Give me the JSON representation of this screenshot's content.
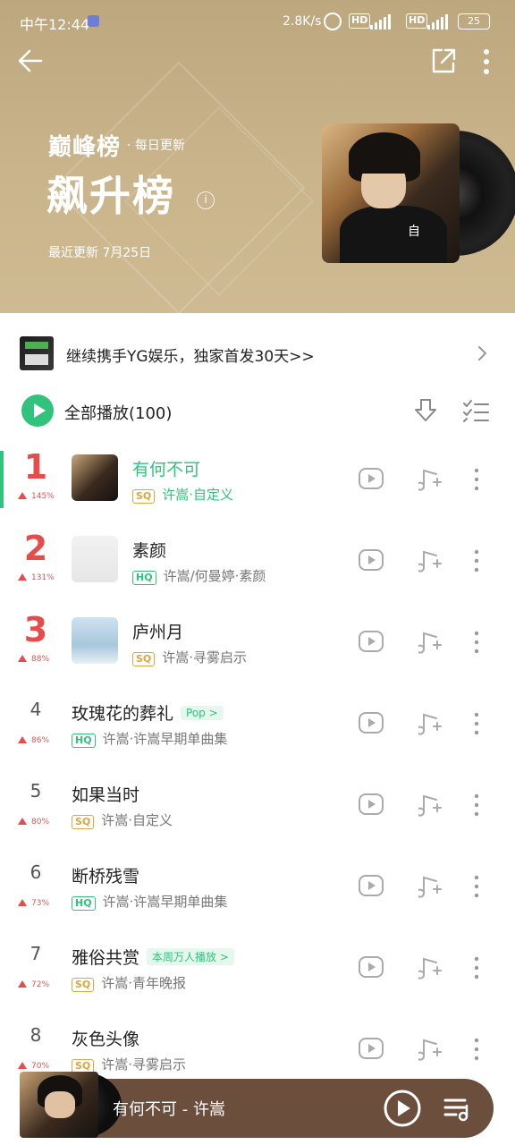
{
  "status_bar": {
    "time": "中午12:44",
    "speed": "2.8K/s",
    "battery": "25",
    "hd1": "HD",
    "hd2": "HD"
  },
  "header": {
    "brand": "巅峰榜",
    "update_freq": "· 每日更新",
    "title": "飙升榜",
    "updated": "最近更新 7月25日",
    "cover_char": "自"
  },
  "promo": {
    "text": "继续携手YG娱乐，独家首发30天>>"
  },
  "play_all": {
    "label": "全部播放(100)"
  },
  "songs": [
    {
      "rank": "1",
      "trend": "145%",
      "title": "有何不可",
      "quality": "SQ",
      "artist": "许嵩·自定义",
      "tag": ""
    },
    {
      "rank": "2",
      "trend": "131%",
      "title": "素颜",
      "quality": "HQ",
      "artist": "许嵩/何曼婷·素颜",
      "tag": ""
    },
    {
      "rank": "3",
      "trend": "88%",
      "title": "庐州月",
      "quality": "SQ",
      "artist": "许嵩·寻雾启示",
      "tag": ""
    },
    {
      "rank": "4",
      "trend": "86%",
      "title": "玫瑰花的葬礼",
      "quality": "HQ",
      "artist": "许嵩·许嵩早期单曲集",
      "tag": "Pop >"
    },
    {
      "rank": "5",
      "trend": "80%",
      "title": "如果当时",
      "quality": "SQ",
      "artist": "许嵩·自定义",
      "tag": ""
    },
    {
      "rank": "6",
      "trend": "73%",
      "title": "断桥残雪",
      "quality": "HQ",
      "artist": "许嵩·许嵩早期单曲集",
      "tag": ""
    },
    {
      "rank": "7",
      "trend": "72%",
      "title": "雅俗共赏",
      "quality": "SQ",
      "artist": "许嵩·青年晚报",
      "tag": "本周万人播放 >"
    },
    {
      "rank": "8",
      "trend": "70%",
      "title": "灰色头像",
      "quality": "SQ",
      "artist": "许嵩·寻雾启示",
      "tag": ""
    }
  ],
  "player": {
    "now_playing": "有何不可 - 许嵩"
  },
  "colors": {
    "accent": "#31c27c",
    "rank_top": "#e74c4c",
    "header_bg": "#c5b087",
    "player_bg": "#6b4f3c"
  }
}
